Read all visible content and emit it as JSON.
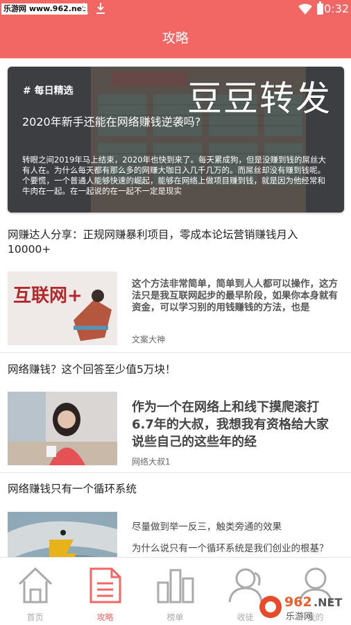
{
  "status_bar": {
    "watermark": "乐游网 www.962.net",
    "time": "10:32",
    "icons": [
      "download-icon",
      "download-icon",
      "wifi-icon",
      "battery-icon"
    ]
  },
  "header": {
    "title": "攻略"
  },
  "featured": {
    "tag": "# 每日精选",
    "image_watermark": "豆豆转发",
    "title": "2020年新手还能在网络赚钱逆袭吗?",
    "summary": "转眼之间2019年马上结束，2020年也快到来了。每天累成狗，但是没赚到钱的屌丝大有人在。为什么每天都有那么多的网赚大咖日入几千几万的。而屌丝却没有赚到钱呢。个要慌，一个普通人能够快速的崛起，能够在网络上做项目赚到钱，就是因为他经常和牛肉在一起。在一起说的在一起不一定是现实"
  },
  "articles": [
    {
      "title": "网赚达人分享：正规网赚暴利项目，零成本论坛营销赚钱月入10000+",
      "thumb_label": "互联网+",
      "excerpt": "这个方法非常简单，简单到人人都可以操作，这方法只是我互联网起步的最早阶段，如果你本身就有资金，可以学习别的用钱赚钱的方法，也是",
      "author": "文案大神"
    },
    {
      "title": "网络赚钱？这个回答至少值5万块！",
      "excerpt": "作为一个在网络上和线下摸爬滚打6.7年的大叔，我想我有资格给大家说些自己的这些年的经",
      "author": "网络大叔1"
    },
    {
      "title": "网络赚钱只有一个循环系统",
      "excerpt": "尽量做到举一反三，触类旁通的效果",
      "excerpt2": "为什么说只有一个循环系统是我们创业的根基？"
    }
  ],
  "bottom_nav": {
    "tabs": [
      {
        "label": "首页",
        "icon": "home-icon"
      },
      {
        "label": "攻略",
        "icon": "document-icon",
        "active": true
      },
      {
        "label": "榜单",
        "icon": "chart-icon"
      },
      {
        "label": "收徒",
        "icon": "users-icon"
      },
      {
        "label": "我的",
        "icon": "profile-icon"
      }
    ]
  },
  "corner_watermark": "962.NET 乐游网",
  "colors": {
    "accent": "#f26664",
    "text": "#222222",
    "muted": "#aaaaaa"
  }
}
